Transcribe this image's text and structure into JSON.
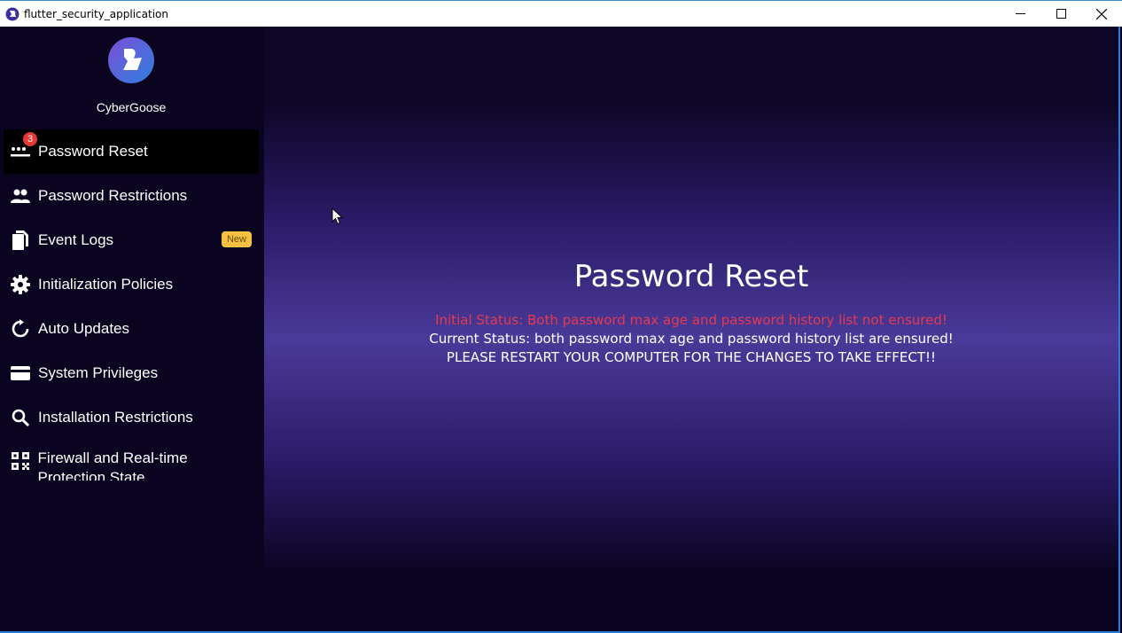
{
  "window": {
    "title": "flutter_security_application"
  },
  "sidebar": {
    "brand": "CyberGoose",
    "items": [
      {
        "label": "Password Reset",
        "icon": "password-icon",
        "badge": "3",
        "active": true
      },
      {
        "label": "Password Restrictions",
        "icon": "people-icon"
      },
      {
        "label": "Event Logs",
        "icon": "documents-icon",
        "tag": "New"
      },
      {
        "label": "Initialization Policies",
        "icon": "gear-icon"
      },
      {
        "label": "Auto Updates",
        "icon": "refresh-icon"
      },
      {
        "label": "System Privileges",
        "icon": "card-icon"
      },
      {
        "label": "Installation Restrictions",
        "icon": "search-icon"
      },
      {
        "label": "Firewall and Real-time Protection State",
        "icon": "qr-code-icon"
      }
    ]
  },
  "main": {
    "title": "Password Reset",
    "initial_status": "Initial Status: Both password max age and password history list not ensured!",
    "current_status": "Current Status: both password max age and password history list are ensured!",
    "restart_notice": "PLEASE RESTART YOUR COMPUTER FOR THE CHANGES TO TAKE EFFECT!!"
  },
  "colors": {
    "sidebar_bg": "#0b0420",
    "active_item_bg": "#000000",
    "badge_red": "#e53935",
    "new_tag": "#f6c142",
    "initial_status_red": "#e53950"
  }
}
